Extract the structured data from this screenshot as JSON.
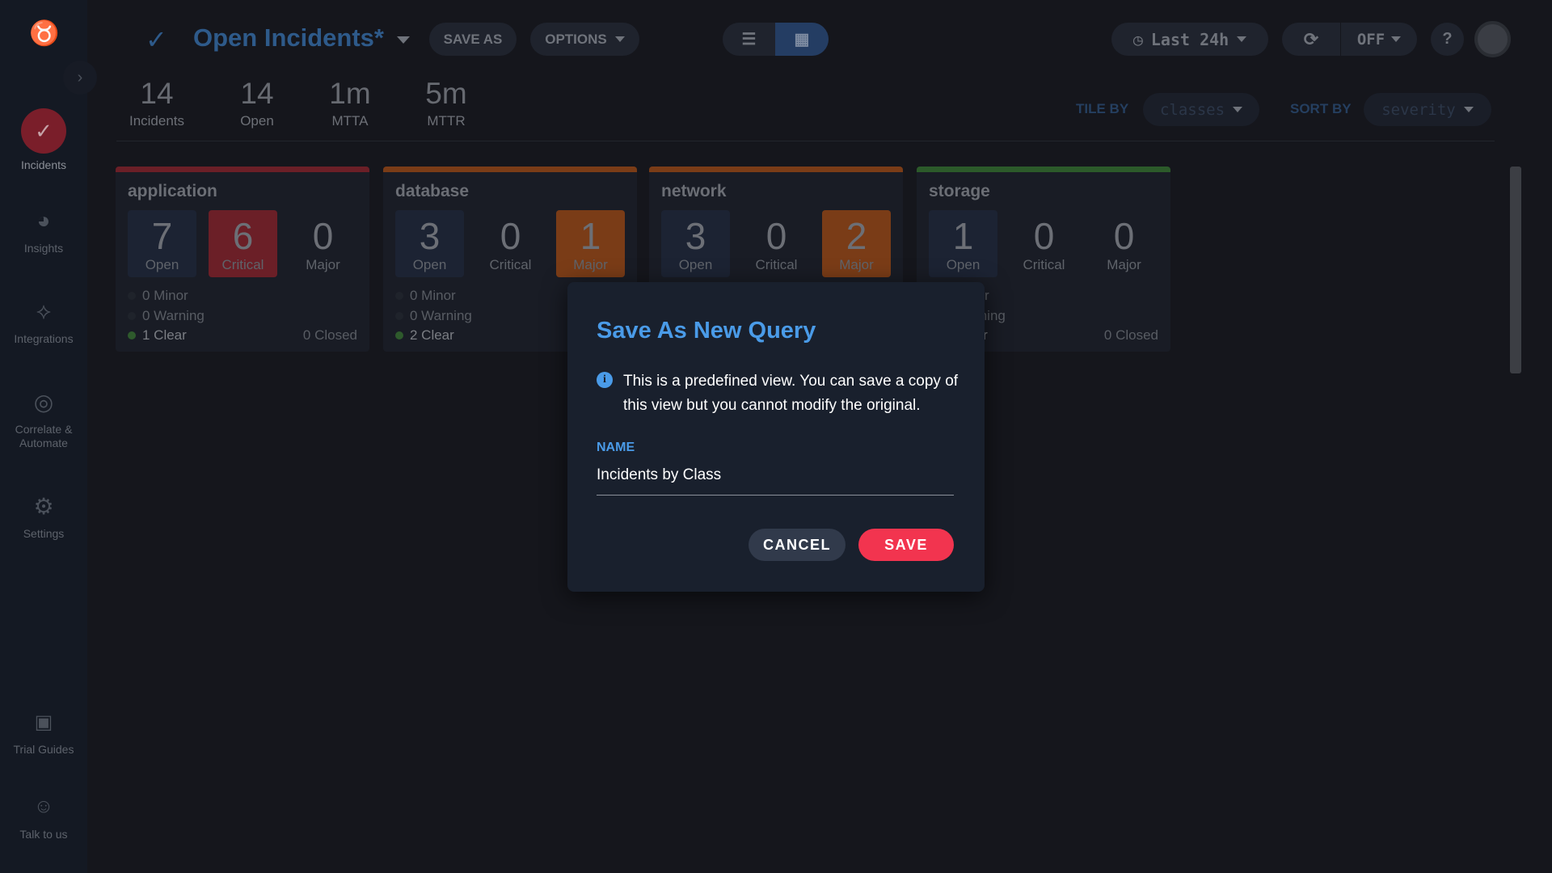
{
  "sidebar": {
    "items": [
      {
        "label": "Incidents",
        "icon": "incidents-icon",
        "active": true
      },
      {
        "label": "Insights",
        "icon": "pie-chart-icon"
      },
      {
        "label": "Integrations",
        "icon": "integrations-icon"
      },
      {
        "label": "Correlate & Automate",
        "icon": "target-icon"
      },
      {
        "label": "Settings",
        "icon": "gear-icon"
      },
      {
        "label": "Trial Guides",
        "icon": "gift-icon"
      },
      {
        "label": "Talk to us",
        "icon": "support-icon"
      }
    ]
  },
  "header": {
    "title": "Open Incidents",
    "modified_marker": "*",
    "save_as": "SAVE AS",
    "options": "OPTIONS",
    "time_range": "Last 24h",
    "refresh_state": "OFF",
    "help": "?"
  },
  "stats": [
    {
      "value": "14",
      "label": "Incidents"
    },
    {
      "value": "14",
      "label": "Open"
    },
    {
      "value": "1m",
      "label": "MTTA"
    },
    {
      "value": "5m",
      "label": "MTTR"
    }
  ],
  "tile_by": {
    "label": "TILE BY",
    "value": "classes"
  },
  "sort_by": {
    "label": "SORT BY",
    "value": "severity"
  },
  "tiles": [
    {
      "name": "application",
      "color": "#6b1f27",
      "open": "7",
      "critical": "6",
      "major": "0",
      "minor": "0 Minor",
      "warning": "0 Warning",
      "clear": "1 Clear",
      "closed": "0 Closed",
      "labels": [
        "Open",
        "Critical",
        "Major"
      ]
    },
    {
      "name": "database",
      "color": "#7a3c17",
      "open": "3",
      "critical": "0",
      "major": "1",
      "minor": "0 Minor",
      "warning": "0 Warning",
      "clear": "2 Clear",
      "closed": "",
      "labels": [
        "Open",
        "Critical",
        "Major"
      ]
    },
    {
      "name": "network",
      "color": "#7a3c17",
      "open": "3",
      "critical": "0",
      "major": "2",
      "minor": "",
      "warning": "",
      "clear": "",
      "closed": "",
      "labels": [
        "Open",
        "Critical",
        "Major"
      ]
    },
    {
      "name": "storage",
      "color": "#2c5a2a",
      "open": "1",
      "critical": "0",
      "major": "0",
      "minor": "0 Minor",
      "warning": "0 Warning",
      "clear": "0 Clear",
      "closed": "0 Closed",
      "labels": [
        "Open",
        "Critical",
        "Major"
      ]
    }
  ],
  "modal": {
    "title": "Save As New Query",
    "info": "This is a predefined view. You can save a copy of this view but you cannot modify the original.",
    "name_label": "NAME",
    "name_value": "Incidents by Class",
    "cancel": "CANCEL",
    "save": "SAVE"
  },
  "colors": {
    "accent": "#4a9be8",
    "save": "#f2344f",
    "critical": "#6b1f27",
    "major": "#7a3c17"
  }
}
